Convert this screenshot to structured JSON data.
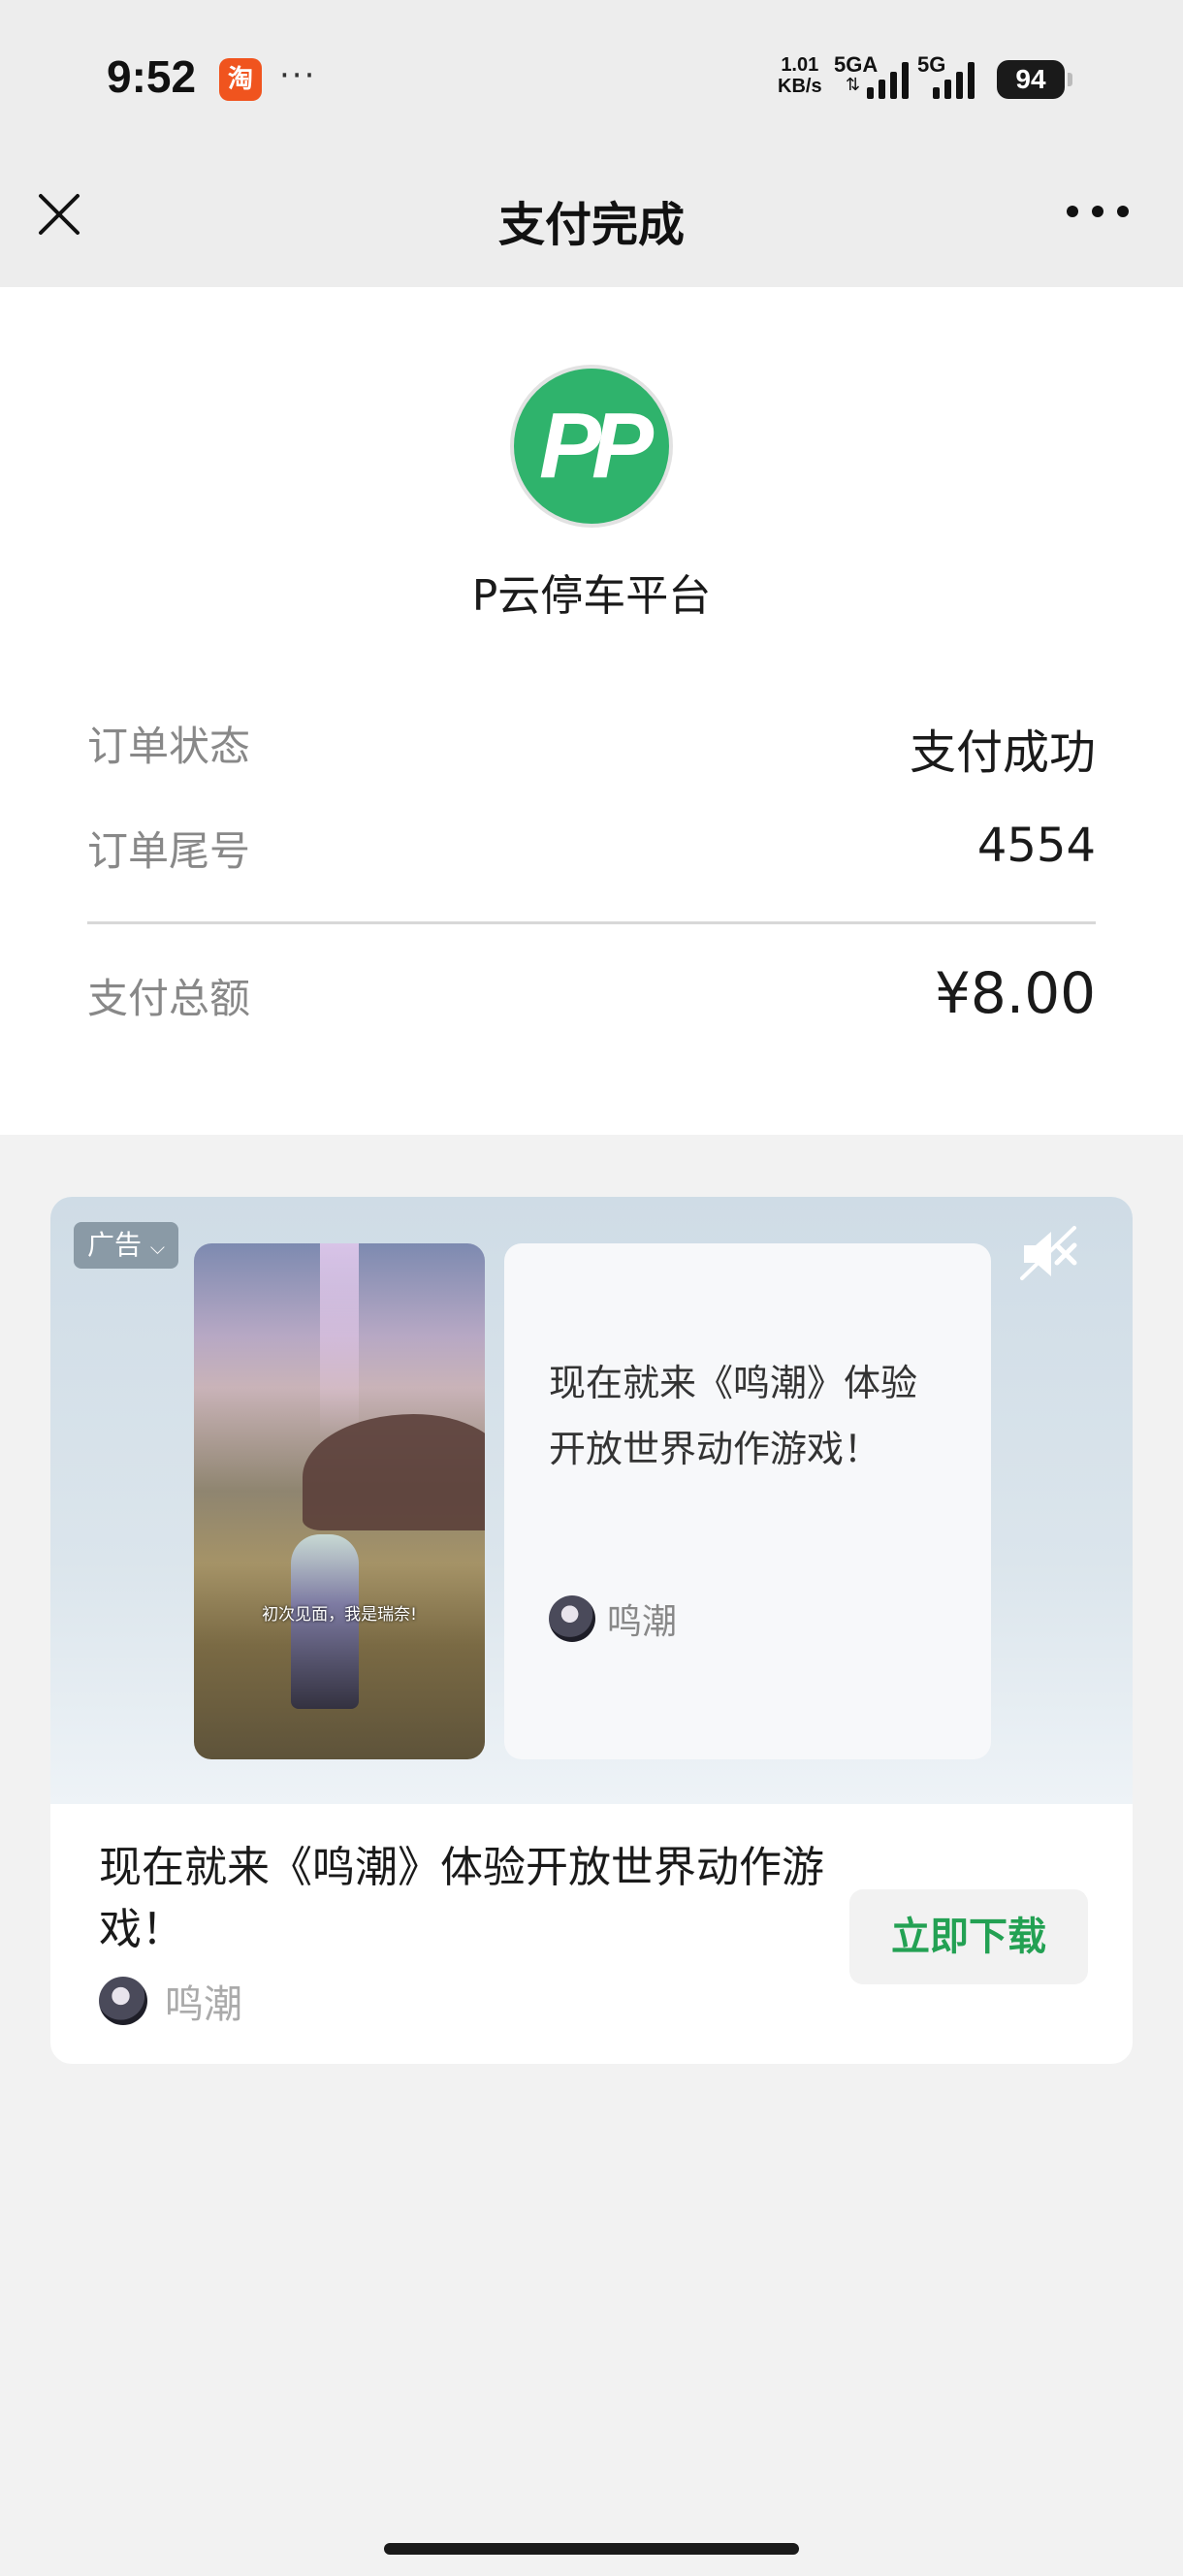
{
  "status_bar": {
    "time": "9:52",
    "app_icon_glyph": "淘",
    "more": "···",
    "net_speed_value": "1.01",
    "net_speed_unit": "KB/s",
    "net1_label": "5GA",
    "net2_label": "5G",
    "battery": "94"
  },
  "nav": {
    "title": "支付完成",
    "close_icon": "close-icon",
    "more_icon": "more-icon"
  },
  "payment": {
    "merchant_logo_text": "PP",
    "merchant_name": "P云停车平台",
    "rows": [
      {
        "label": "订单状态",
        "value": "支付成功"
      },
      {
        "label": "订单尾号",
        "value": "4554"
      },
      {
        "label": "支付总额",
        "value": "¥8.00"
      }
    ]
  },
  "ad": {
    "tag": "广告",
    "tag_icon": "chevron-down-icon",
    "mute_icon": "muted-speaker-icon",
    "video_caption": "初次见面，我是瑞奈!",
    "card_text": "现在就来《鸣潮》体验开放世界动作游戏！",
    "brand_name": "鸣潮",
    "bottom_title": "现在就来《鸣潮》体验开放世界动作游戏！",
    "download_label": "立即下载",
    "download_color": "#23a153"
  },
  "colors": {
    "merchant_green": "#2fb36c",
    "page_bg": "#f2f2f2",
    "nav_bg": "#ededed"
  }
}
